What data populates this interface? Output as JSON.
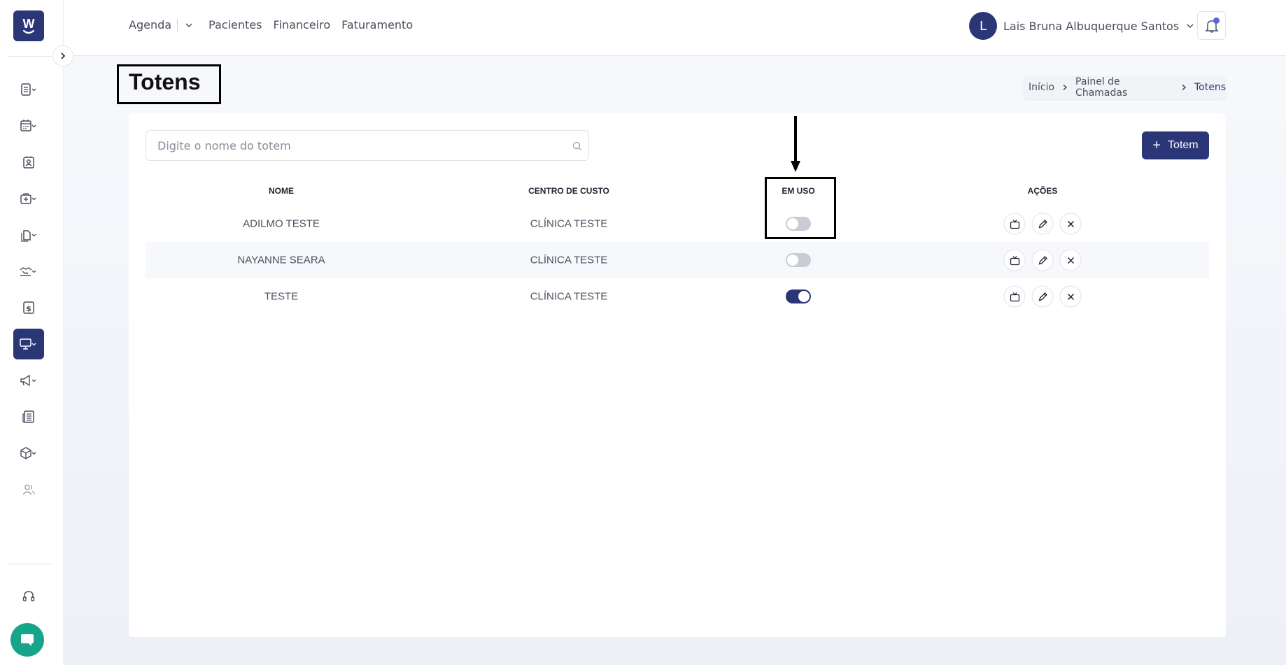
{
  "logo_letter": "W",
  "topnav": {
    "agenda": "Agenda",
    "pacientes": "Pacientes",
    "financeiro": "Financeiro",
    "faturamento": "Faturamento"
  },
  "user": {
    "initial": "L",
    "name": "Lais Bruna Albuquerque Santos"
  },
  "page": {
    "title": "Totens"
  },
  "breadcrumb": {
    "items": [
      "Início",
      "Painel de Chamadas",
      "Totens"
    ]
  },
  "search": {
    "placeholder": "Digite o nome do totem",
    "value": ""
  },
  "add_button": {
    "plus": "+",
    "label": "Totem"
  },
  "table": {
    "headers": {
      "nome": "NOME",
      "centro": "CENTRO DE CUSTO",
      "em_uso": "EM USO",
      "acoes": "AÇÕES"
    },
    "rows": [
      {
        "nome": "ADILMO TESTE",
        "centro": "CLÍNICA TESTE",
        "em_uso": false
      },
      {
        "nome": "NAYANNE SEARA",
        "centro": "CLÍNICA TESTE",
        "em_uso": false
      },
      {
        "nome": "TESTE",
        "centro": "CLÍNICA TESTE",
        "em_uso": true
      }
    ]
  },
  "colors": {
    "primary": "#2b3676",
    "chat": "#17a589",
    "notification_dot": "#5b63e6"
  },
  "icons": {
    "sidebar": [
      "menu-list-icon",
      "calendar-icon",
      "patient-card-icon",
      "medical-kit-icon",
      "documents-icon",
      "handshake-icon",
      "dollar-icon",
      "monitor-icon",
      "megaphone-icon",
      "newspaper-icon",
      "package-icon",
      "users-icon",
      "headset-icon"
    ],
    "row_actions": [
      "tv-icon",
      "pencil-icon",
      "close-icon"
    ]
  }
}
